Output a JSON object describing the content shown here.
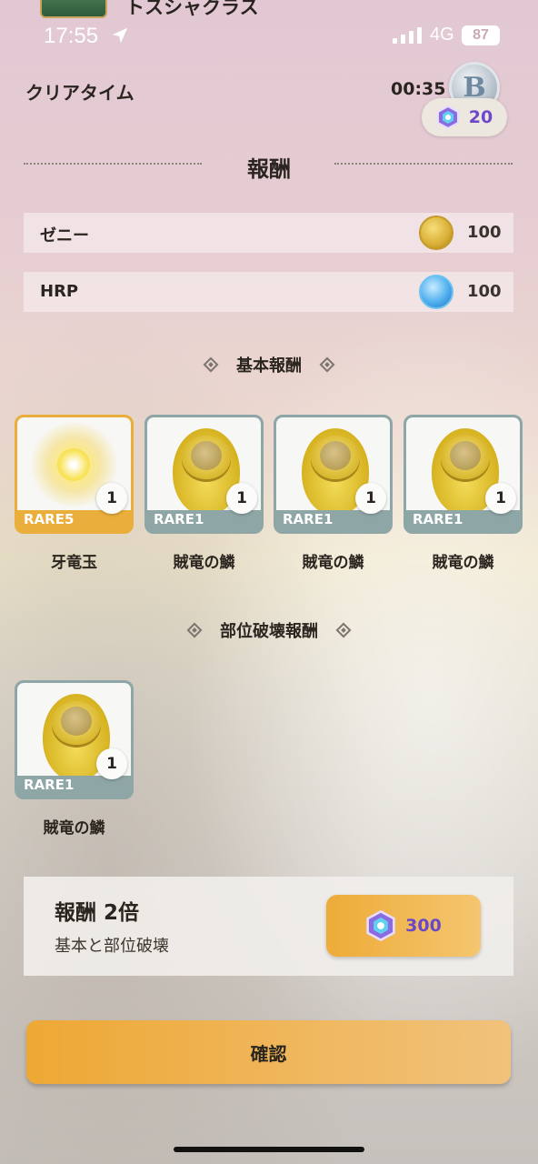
{
  "status_bar": {
    "game_title": "トスシャクラス",
    "time": "17:55",
    "network": "4G",
    "battery": "87"
  },
  "result": {
    "clear_time_label": "クリアタイム",
    "clear_time_value": "00:35",
    "rank": "B",
    "gem_balance": "20"
  },
  "rewards": {
    "title": "報酬",
    "currency_rows": [
      {
        "label": "ゼニー",
        "icon": "zeny-coin-icon",
        "value": "100"
      },
      {
        "label": "HRP",
        "icon": "hrp-icon",
        "value": "100"
      }
    ],
    "basic_title": "基本報酬",
    "basic_items": [
      {
        "rarity": "RARE5",
        "count": "1",
        "name": "牙竜玉",
        "icon": "fang-dragon-orb-icon"
      },
      {
        "rarity": "RARE1",
        "count": "1",
        "name": "賊竜の鱗",
        "icon": "dragon-scale-icon"
      },
      {
        "rarity": "RARE1",
        "count": "1",
        "name": "賊竜の鱗",
        "icon": "dragon-scale-icon"
      },
      {
        "rarity": "RARE1",
        "count": "1",
        "name": "賊竜の鱗",
        "icon": "dragon-scale-icon"
      }
    ],
    "break_title": "部位破壊報酬",
    "break_items": [
      {
        "rarity": "RARE1",
        "count": "1",
        "name": "賊竜の鱗",
        "icon": "dragon-scale-icon"
      }
    ]
  },
  "double_reward": {
    "title": "報酬 2倍",
    "subtitle": "基本と部位破壊",
    "cost": "300"
  },
  "confirm_label": "確認",
  "colors": {
    "rare1": "#8fa6a6",
    "rare5": "#e9ae3c",
    "button_orange": "#eeab37",
    "gem_text": "#6a49c8"
  }
}
